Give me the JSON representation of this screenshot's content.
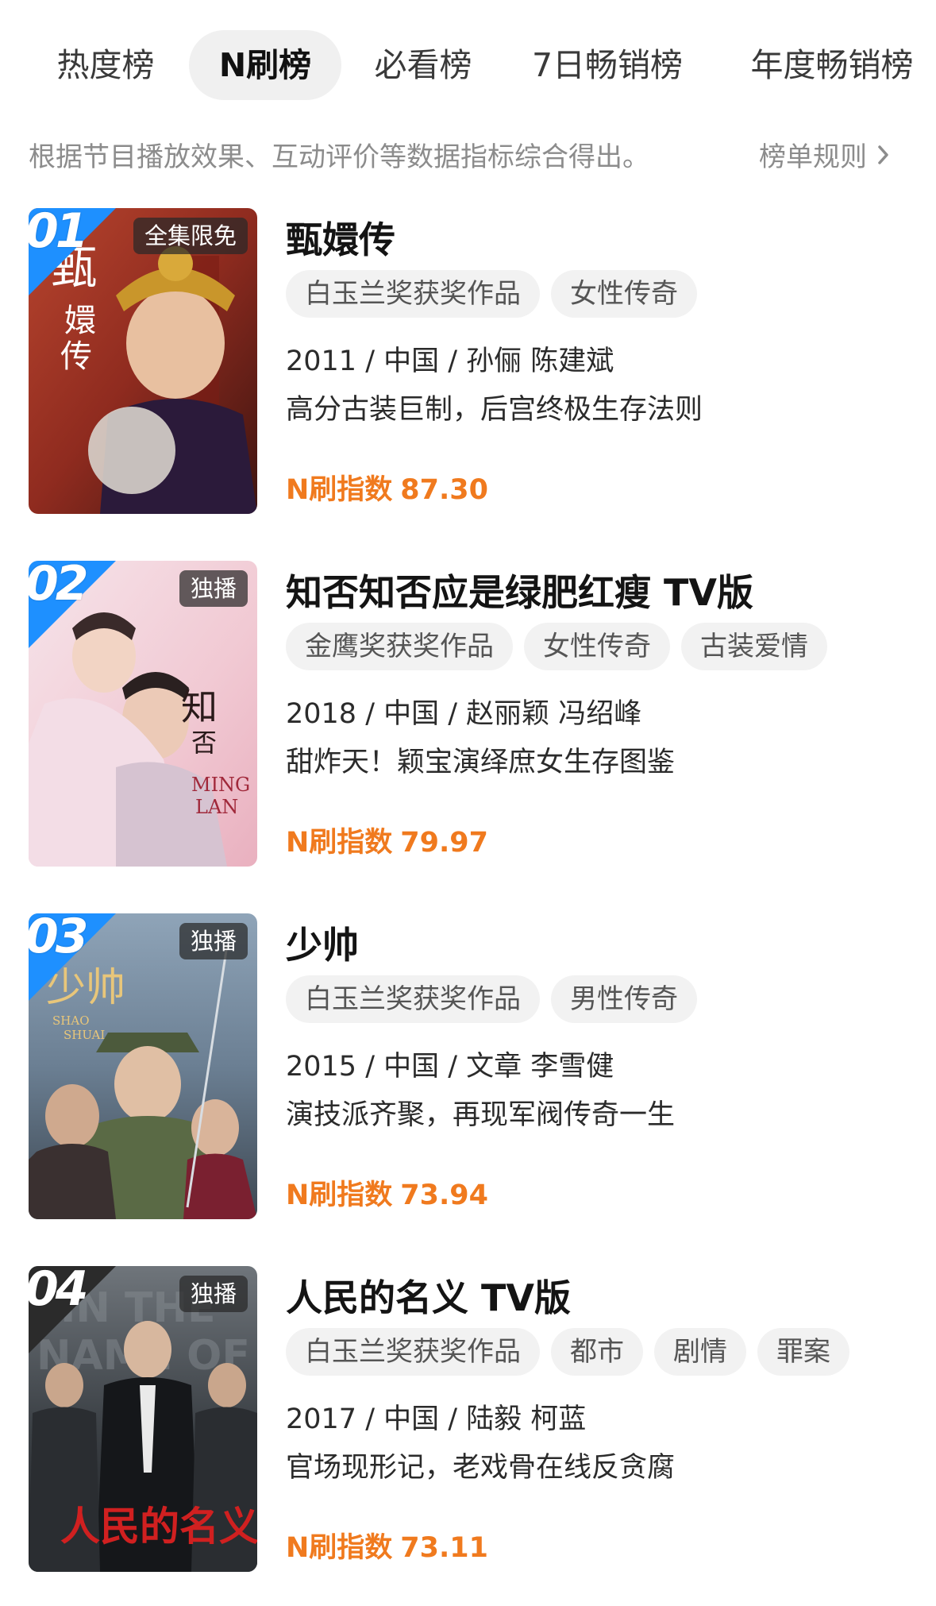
{
  "tabs": [
    {
      "label": "热度榜",
      "active": false
    },
    {
      "label": "N刷榜",
      "active": true
    },
    {
      "label": "必看榜",
      "active": false
    },
    {
      "label": "7日畅销榜",
      "active": false
    },
    {
      "label": "年度畅销榜",
      "active": false
    }
  ],
  "description": "根据节目播放效果、互动评价等数据指标综合得出。",
  "rules_link": "榜单规则",
  "score_label": "N刷指数",
  "colors": {
    "accent_orange": "#f07a1e",
    "rank_blue": "#1e90ff",
    "rank_dark": "#2b2b2b",
    "tag_bg": "#f2f2f2"
  },
  "items": [
    {
      "rank": "01",
      "badge": "全集限免",
      "title": "甄嬛传",
      "tags": [
        "白玉兰奖获奖作品",
        "女性传奇"
      ],
      "meta": "2011 / 中国 / 孙俪 陈建斌",
      "tagline": "高分古装巨制，后宫终极生存法则",
      "score": "87.30",
      "poster_text": "甄嬛传"
    },
    {
      "rank": "02",
      "badge": "独播",
      "title": "知否知否应是绿肥红瘦 TV版",
      "tags": [
        "金鹰奖获奖作品",
        "女性传奇",
        "古装爱情"
      ],
      "meta": "2018 / 中国 / 赵丽颖 冯绍峰",
      "tagline": "甜炸天！颖宝演绎庶女生存图鉴",
      "score": "79.97",
      "poster_text": "知否知否"
    },
    {
      "rank": "03",
      "badge": "独播",
      "title": "少帅",
      "tags": [
        "白玉兰奖获奖作品",
        "男性传奇"
      ],
      "meta": "2015 / 中国 / 文章 李雪健",
      "tagline": "演技派齐聚，再现军阀传奇一生",
      "score": "73.94",
      "poster_text": "少帅"
    },
    {
      "rank": "04",
      "badge": "独播",
      "title": "人民的名义 TV版",
      "tags": [
        "白玉兰奖获奖作品",
        "都市",
        "剧情",
        "罪案"
      ],
      "meta": "2017 / 中国 / 陆毅 柯蓝",
      "tagline": "官场现形记，老戏骨在线反贪腐",
      "score": "73.11",
      "poster_text": "人民的名义"
    }
  ]
}
